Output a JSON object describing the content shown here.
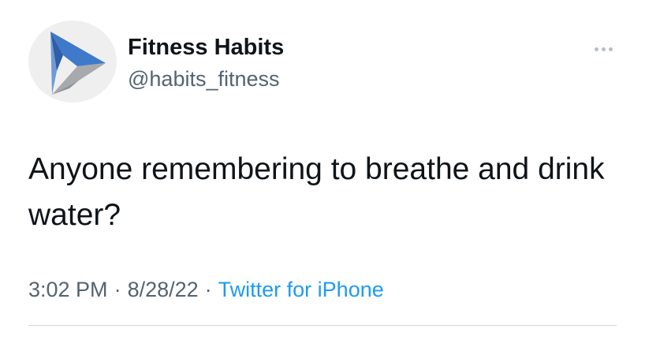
{
  "author": {
    "name": "Fitness Habits",
    "handle": "@habits_fitness",
    "avatar_icon": "play-triangle-logo-icon"
  },
  "more_icon": "more-horizontal-icon",
  "tweet": {
    "text": "Anyone remembering to breathe and drink water?",
    "time": "3:02 PM",
    "date": "8/28/22",
    "separator": "·",
    "source": "Twitter for iPhone"
  },
  "colors": {
    "text": "#0f1419",
    "secondary": "#536471",
    "link": "#1d9bf0",
    "divider": "#cfd9de",
    "logo_blue": "#3f79c9",
    "logo_grey": "#a7a9ac"
  }
}
